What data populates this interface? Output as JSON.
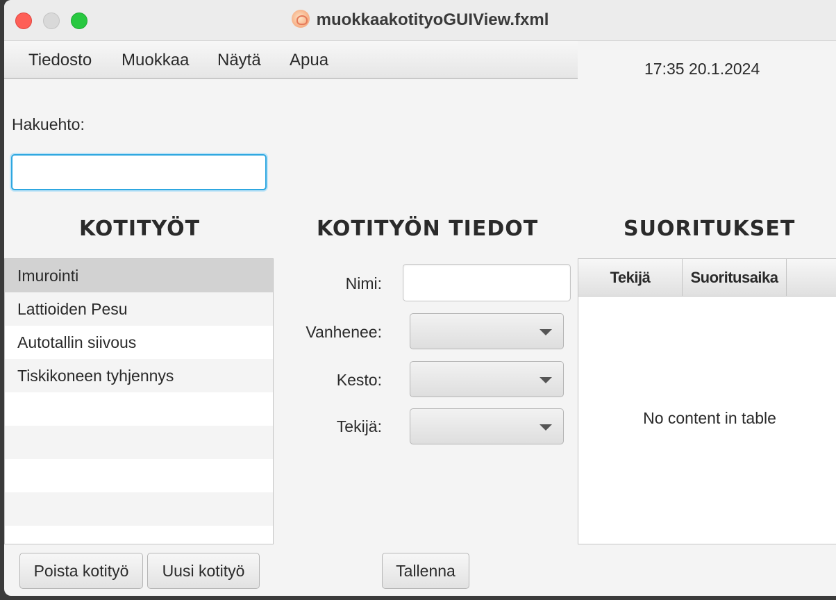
{
  "window": {
    "title": "muokkaakotityoGUIView.fxml"
  },
  "menubar": {
    "items": [
      "Tiedosto",
      "Muokkaa",
      "Näytä",
      "Apua"
    ]
  },
  "clock": {
    "text": "17:35 20.1.2024"
  },
  "search": {
    "label": "Hakuehto:",
    "value": "",
    "placeholder": ""
  },
  "kotityot": {
    "heading": "KOTITYÖT",
    "items": [
      "Imurointi",
      "Lattioiden Pesu",
      "Autotallin siivous",
      "Tiskikoneen tyhjennys"
    ],
    "selected_index": 0,
    "buttons": {
      "delete": "Poista kotityö",
      "new": "Uusi kotityö"
    }
  },
  "tiedot": {
    "heading": "KOTITYÖN TIEDOT",
    "fields": {
      "nimi": "Nimi:",
      "vanhenee": "Vanhenee:",
      "kesto": "Kesto:",
      "tekija": "Tekijä:"
    },
    "values": {
      "nimi": "",
      "vanhenee": "",
      "kesto": "",
      "tekija": ""
    },
    "save": "Tallenna"
  },
  "suoritukset": {
    "heading": "SUORITUKSET",
    "columns": [
      "Tekijä",
      "Suoritusaika",
      ""
    ],
    "empty_message": "No content in table"
  },
  "colors": {
    "focus": "#2ea7e0",
    "selected_row": "#d2d2d2",
    "close": "#fe5f57",
    "maximize": "#28c840"
  }
}
